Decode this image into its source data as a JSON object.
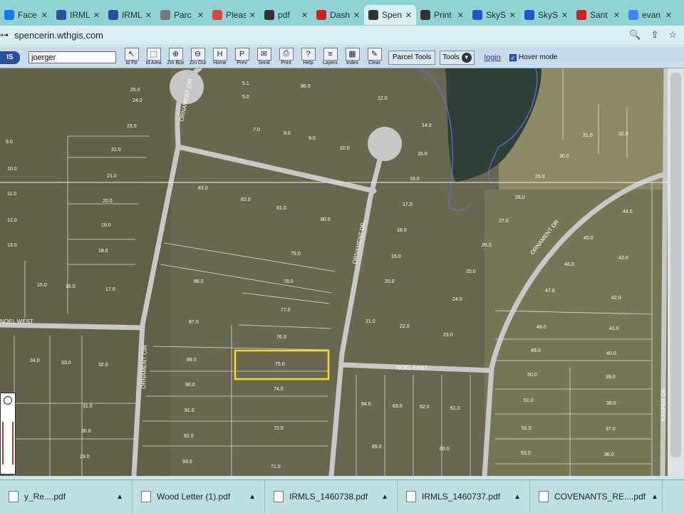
{
  "tabs": [
    {
      "label": "Face",
      "color": "#1877f2"
    },
    {
      "label": "IRML",
      "color": "#2a4f9a"
    },
    {
      "label": "IRML",
      "color": "#2a4f9a"
    },
    {
      "label": "Parc",
      "color": "#777"
    },
    {
      "label": "Pleas",
      "color": "#d44"
    },
    {
      "label": "pdf",
      "color": "#333"
    },
    {
      "label": "Dash",
      "color": "#c22"
    },
    {
      "label": "Spen",
      "color": "#333"
    },
    {
      "label": "Print",
      "color": "#333"
    },
    {
      "label": "SkyS",
      "color": "#2255cc"
    },
    {
      "label": "SkyS",
      "color": "#2255cc"
    },
    {
      "label": "Sant",
      "color": "#c22"
    },
    {
      "label": "evan",
      "color": "#4285f4"
    }
  ],
  "address": {
    "url": "spencerin.wthgis.com"
  },
  "toolbar": {
    "logo": "IS",
    "search_value": "joerger",
    "tools": [
      {
        "label": "Id Ftr",
        "glyph": "↖"
      },
      {
        "label": "Id Area",
        "glyph": "⬚"
      },
      {
        "label": "Zm Box",
        "glyph": "⊕"
      },
      {
        "label": "Zm Out",
        "glyph": "⊖"
      },
      {
        "label": "Home",
        "glyph": "H"
      },
      {
        "label": "Prev",
        "glyph": "P"
      },
      {
        "label": "Send",
        "glyph": "✉"
      },
      {
        "label": "Print",
        "glyph": "⎙"
      },
      {
        "label": "Help",
        "glyph": "?"
      },
      {
        "label": "Layers",
        "glyph": "≡"
      },
      {
        "label": "Index",
        "glyph": "▦"
      },
      {
        "label": "Clear",
        "glyph": "✎"
      }
    ],
    "parcel_tools": "Parcel Tools",
    "tools_menu": "Tools",
    "login": "login",
    "hover_mode": "Hover mode"
  },
  "map": {
    "streets": [
      "ORNAMENT CIR",
      "ORNAMENT CIR",
      "ORNAMENT DR",
      "ORNAMENT DR",
      "NOEL EAST",
      "NOEL WEST",
      "KASPER DR"
    ],
    "lots": [
      "25.0",
      "5.1",
      "5.0",
      "96.0",
      "12.0",
      "24.0",
      "23.0",
      "7.0",
      "8.0",
      "9.0",
      "10.0",
      "14.0",
      "15.0",
      "16.0",
      "22.0",
      "21.0",
      "83.0",
      "82.0",
      "81.0",
      "80.0",
      "17.0",
      "18.0",
      "19.0",
      "20.0",
      "9.0",
      "10.0",
      "11.0",
      "12.0",
      "13.0",
      "15.0",
      "16.0",
      "17.0",
      "18.0",
      "19.0",
      "20.0",
      "79.0",
      "78.0",
      "77.0",
      "86.0",
      "87.0",
      "76.0",
      "75.0",
      "74.0",
      "89.0",
      "90.0",
      "91.0",
      "92.0",
      "93.0",
      "72.0",
      "71.0",
      "21.0",
      "22.0",
      "23.0",
      "84.0",
      "63.0",
      "62.0",
      "61.0",
      "65.0",
      "60.0",
      "34.0",
      "33.0",
      "32.0",
      "31.0",
      "30.0",
      "29.0",
      "31.0",
      "32.0",
      "30.0",
      "29.0",
      "28.0",
      "27.0",
      "26.0",
      "25.0",
      "24.0",
      "44.0",
      "45.0",
      "46.0",
      "43.0",
      "47.0",
      "42.0",
      "48.0",
      "41.0",
      "49.0",
      "40.0",
      "50.0",
      "39.0",
      "51.0",
      "38.0",
      "52.0",
      "37.0",
      "53.0",
      "36.0"
    ]
  },
  "downloads": [
    {
      "name": "y_Re....pdf"
    },
    {
      "name": "Wood Letter (1).pdf"
    },
    {
      "name": "IRMLS_1460738.pdf"
    },
    {
      "name": "IRMLS_1460737.pdf"
    },
    {
      "name": "COVENANTS_RE....pdf"
    }
  ]
}
